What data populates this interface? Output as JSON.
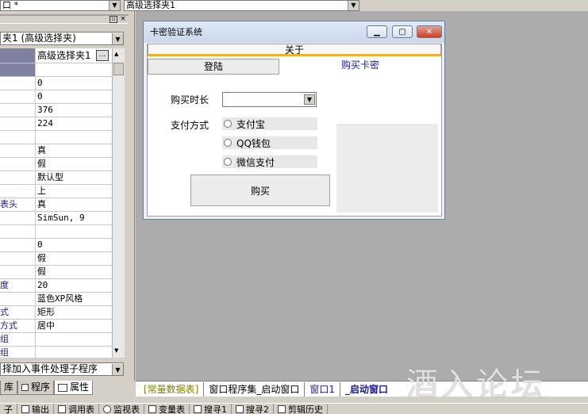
{
  "topbar": {
    "left_combo": "口 *",
    "right_combo": "高级选择夹1"
  },
  "panel": {
    "object_combo": "夹1 (高级选择夹)",
    "header_value": "高级选择夹1",
    "ellipsis": "...",
    "rows": [
      {
        "k": "",
        "v": "",
        "bold": true
      },
      {
        "k": "",
        "v": "0"
      },
      {
        "k": "",
        "v": "0"
      },
      {
        "k": "",
        "v": "376"
      },
      {
        "k": "",
        "v": "224"
      },
      {
        "k": "",
        "v": ""
      },
      {
        "k": "",
        "v": "真"
      },
      {
        "k": "",
        "v": "假"
      },
      {
        "k": "",
        "v": "默认型"
      },
      {
        "k": "",
        "v": "上"
      },
      {
        "k": "表头",
        "v": "真"
      },
      {
        "k": "",
        "v": "SimSun, 9"
      },
      {
        "k": "",
        "v": ""
      },
      {
        "k": "",
        "v": "0"
      },
      {
        "k": "",
        "v": "假"
      },
      {
        "k": "",
        "v": "假"
      },
      {
        "k": "度",
        "v": "20"
      },
      {
        "k": "",
        "v": "蓝色XP风格"
      },
      {
        "k": "式",
        "v": "矩形"
      },
      {
        "k": "方式",
        "v": "居中"
      },
      {
        "k": "组",
        "v": ""
      },
      {
        "k": "组",
        "v": ""
      }
    ],
    "event_combo": "择加入事件处理子程序",
    "tabs": [
      "库",
      "程序",
      "属性"
    ]
  },
  "dialog": {
    "title": "卡密验证系统",
    "tab_top": "关于",
    "tab_login": "登陆",
    "tab_buy": "购买卡密",
    "label_duration": "购买时长",
    "label_payment": "支付方式",
    "options": [
      "支付宝",
      "QQ钱包",
      "微信支付"
    ],
    "buy_button": "购买"
  },
  "bottomtabs": [
    "[常量数据表]",
    "窗口程序集_启动窗口",
    "窗口1",
    "_启动窗口"
  ],
  "status": [
    "子",
    "输出",
    "调用表",
    "监视表",
    "变量表",
    "搜寻1",
    "搜寻2",
    "剪辑历史"
  ],
  "watermark": "酒入论坛"
}
